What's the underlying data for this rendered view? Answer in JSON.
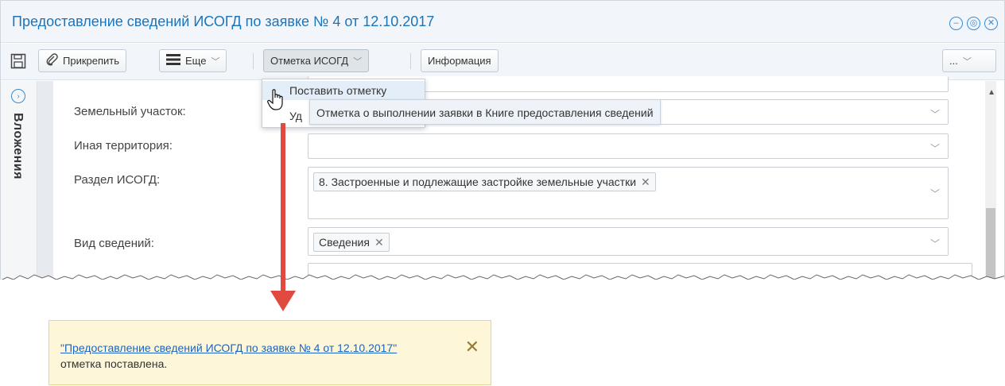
{
  "window": {
    "title": "Предоставление сведений ИСОГД по заявке № 4 от 12.10.2017"
  },
  "toolbar": {
    "attach_label": "Прикрепить",
    "more_label": "Еще",
    "isogd_mark_label": "Отметка ИСОГД",
    "info_label": "Информация",
    "overflow_label": "..."
  },
  "sidebar": {
    "label": "Вложения"
  },
  "form": {
    "land_plot_label": "Земельный участок:",
    "other_territory_label": "Иная территория:",
    "isogd_section_label": "Раздел ИСОГД:",
    "isogd_section_value": "8. Застроенные и подлежащие застройке земельные участки",
    "info_type_label": "Вид сведений:",
    "info_type_value": "Сведения"
  },
  "dropdown_menu": {
    "items": [
      {
        "label": "Поставить отметку"
      },
      {
        "label": "Уд"
      }
    ]
  },
  "tooltip": {
    "text": "Отметка о выполнении заявки в Книге предоставления сведений"
  },
  "notification": {
    "link_text": "\"Предоставление сведений ИСОГД по заявке № 4 от 12.10.2017\"",
    "message": "отметка поставлена."
  },
  "colors": {
    "title": "#1c74b9",
    "arrow": "#e04a3f",
    "notification_bg": "#fdf6d8",
    "link": "#1c64c0"
  }
}
